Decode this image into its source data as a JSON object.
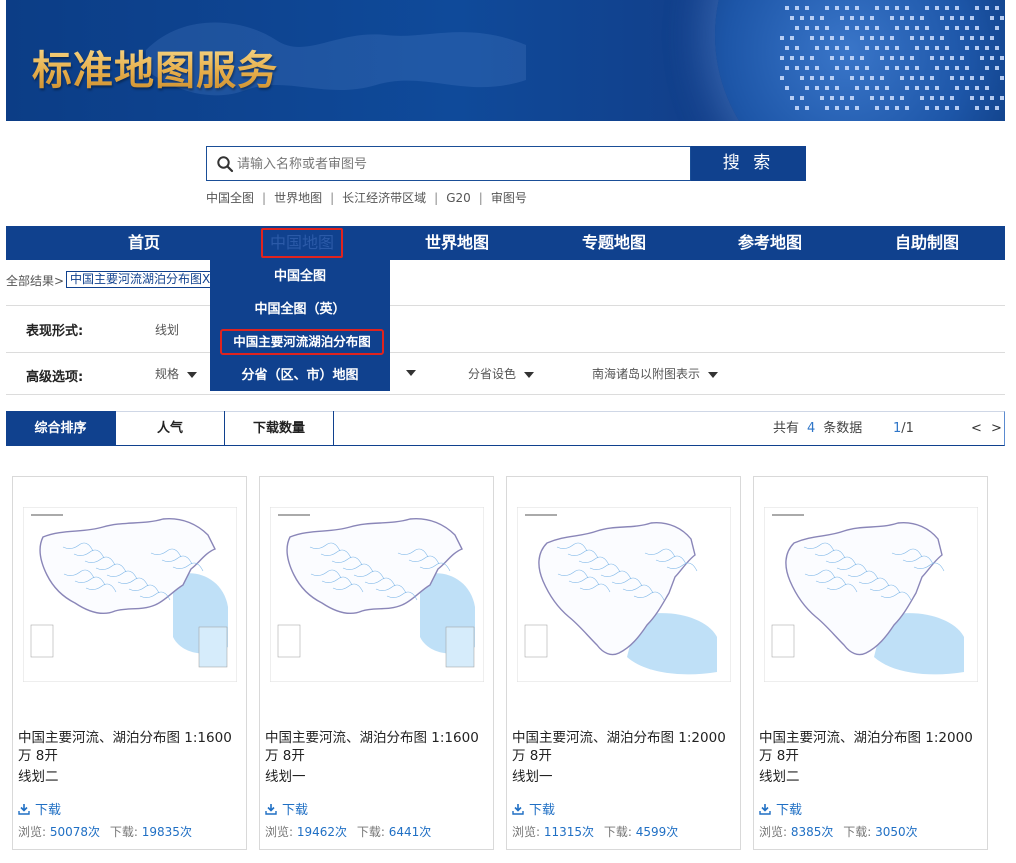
{
  "banner": {
    "title": "标准地图服务"
  },
  "search": {
    "placeholder": "请输入名称或者审图号",
    "button_label": "搜 索"
  },
  "quick_links": [
    "中国全图",
    "世界地图",
    "长江经济带区域",
    "G20",
    "审图号"
  ],
  "nav": {
    "items": [
      "首页",
      "中国地图",
      "世界地图",
      "专题地图",
      "参考地图",
      "自助制图"
    ],
    "active_index": 1
  },
  "dropdown": {
    "items": [
      "中国全图",
      "中国全图（英）",
      "中国主要河流湖泊分布图",
      "分省（区、市）地图"
    ],
    "highlighted_index": 2
  },
  "breadcrumb": {
    "root": "全部结果>",
    "tag": "中国主要河流湖泊分布图X"
  },
  "filters": {
    "form_label": "表现形式:",
    "form_value": "线划",
    "advanced_label": "高级选项:",
    "advanced_options": [
      "规格",
      "分省设色",
      "南海诸岛以附图表示"
    ]
  },
  "sort": {
    "tabs": [
      "综合排序",
      "人气",
      "下载数量"
    ],
    "active_index": 0,
    "total_prefix": "共有",
    "total": "4",
    "total_suffix": "条数据",
    "page_current": "1",
    "page_total": "/1",
    "prev": "<",
    "next": ">"
  },
  "cards": [
    {
      "title": "中国主要河流、湖泊分布图 1:1600万 8开",
      "style": "线划二",
      "download_label": "下载",
      "views_label": "浏览:",
      "views": "50078次",
      "downloads_label": "下载:",
      "downloads": "19835次"
    },
    {
      "title": "中国主要河流、湖泊分布图 1:1600万 8开",
      "style": "线划一",
      "download_label": "下载",
      "views_label": "浏览:",
      "views": "19462次",
      "downloads_label": "下载:",
      "downloads": "6441次"
    },
    {
      "title": "中国主要河流、湖泊分布图 1:2000万 8开",
      "style": "线划一",
      "download_label": "下载",
      "views_label": "浏览:",
      "views": "11315次",
      "downloads_label": "下载:",
      "downloads": "4599次"
    },
    {
      "title": "中国主要河流、湖泊分布图 1:2000万 8开",
      "style": "线划二",
      "download_label": "下载",
      "views_label": "浏览:",
      "views": "8385次",
      "downloads_label": "下载:",
      "downloads": "3050次"
    }
  ],
  "colors": {
    "primary": "#10418e",
    "highlight": "#e0231e",
    "link": "#1f6fc4",
    "banner_title": "#e7b04d"
  }
}
